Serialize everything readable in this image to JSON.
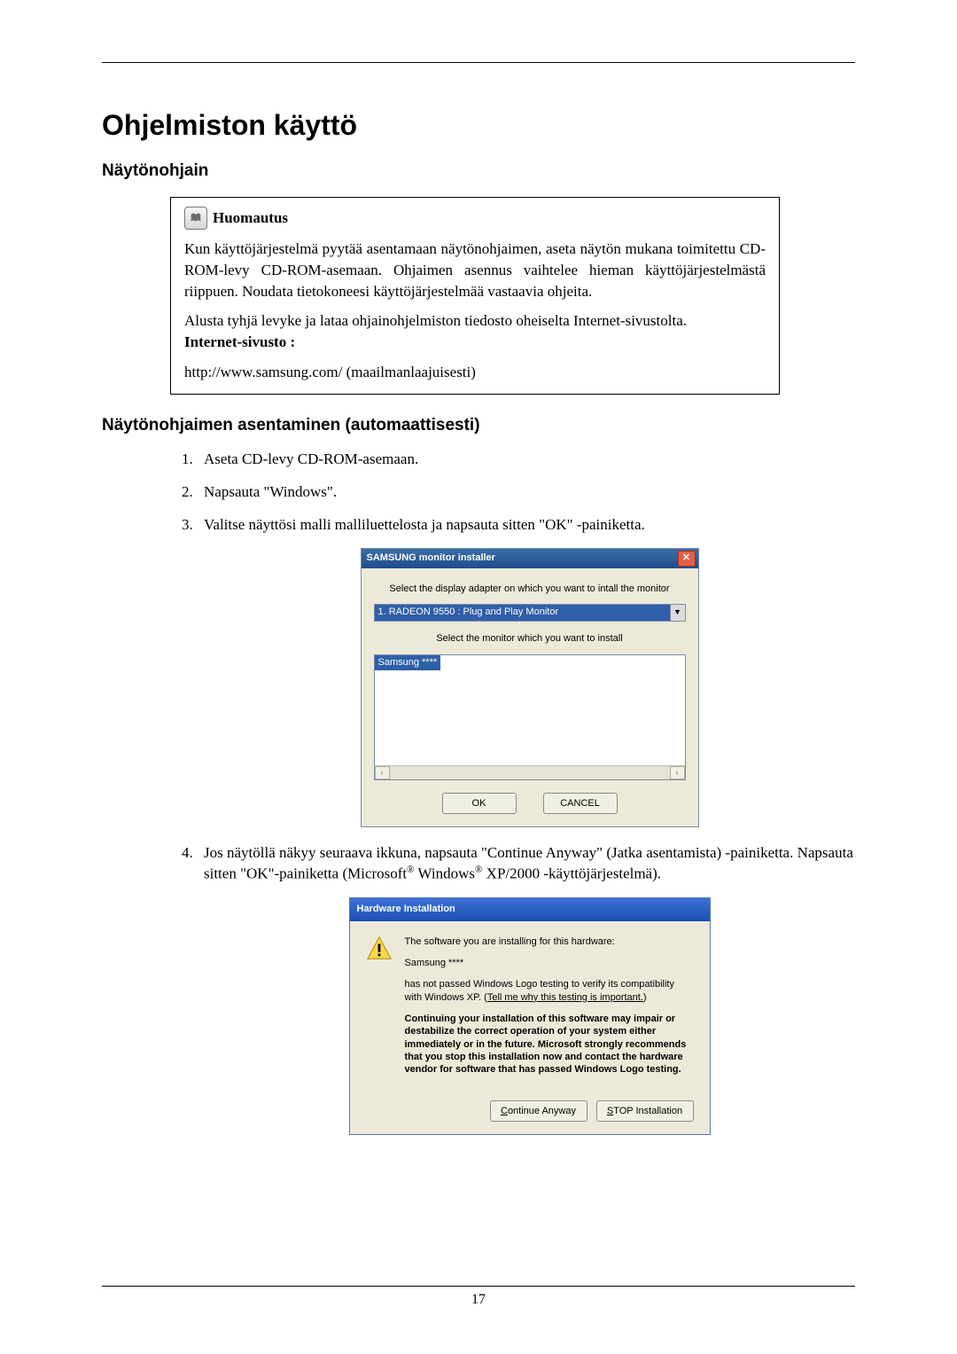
{
  "heading": "Ohjelmiston käyttö",
  "section1": "Näytönohjain",
  "note": {
    "title": "Huomautus",
    "p1": "Kun käyttöjärjestelmä pyytää asentamaan näytönohjaimen, aseta näytön mukana toimitettu CD-ROM-levy CD-ROM-asemaan. Ohjaimen asennus vaihtelee hieman käyttöjärjestelmästä riippuen. Noudata tietokoneesi käyttöjärjestelmää vastaavia ohjeita.",
    "p2": "Alusta tyhjä levyke ja lataa ohjainohjelmiston tiedosto oheiselta Internet-sivustolta.",
    "site_label": "Internet-sivusto :",
    "url": "http://www.samsung.com/ (maailmanlaajuisesti)"
  },
  "section2": "Näytönohjaimen asentaminen (automaattisesti)",
  "steps": {
    "s1": "Aseta CD-levy CD-ROM-asemaan.",
    "s2": "Napsauta \"Windows\".",
    "s3": "Valitse näyttösi malli malliluettelosta ja napsauta sitten \"OK\" -painiketta.",
    "s4a": "Jos näytöllä näkyy seuraava ikkuna, napsauta \"Continue Anyway\" (Jatka asentamista) -painiketta. Napsauta sitten \"OK\"-painiketta (Microsoft",
    "s4b": " Windows",
    "s4c": " XP/2000 -käyttöjärjestelmä)."
  },
  "dlg1": {
    "title": "SAMSUNG monitor installer",
    "line1": "Select the display adapter on which you want to intall the monitor",
    "combo": "1. RADEON 9550 : Plug and Play Monitor",
    "line2": "Select the monitor which you want to install",
    "item": "Samsung ****",
    "ok": "OK",
    "cancel": "CANCEL"
  },
  "dlg2": {
    "title": "Hardware Installation",
    "p1": "The software you are installing for this hardware:",
    "p2": "Samsung ****",
    "p3a": "has not passed Windows Logo testing to verify its compatibility with Windows XP. (",
    "p3link": "Tell me why this testing is important.",
    "p3b": ")",
    "p4": "Continuing your installation of this software may impair or destabilize the correct operation of your system either immediately or in the future. Microsoft strongly recommends that you stop this installation now and contact the hardware vendor for software that has passed Windows Logo testing.",
    "btn1_pre": "C",
    "btn1_rest": "ontinue Anyway",
    "btn2_pre": "S",
    "btn2_rest": "TOP Installation"
  },
  "pagenum": "17",
  "reg": "®"
}
